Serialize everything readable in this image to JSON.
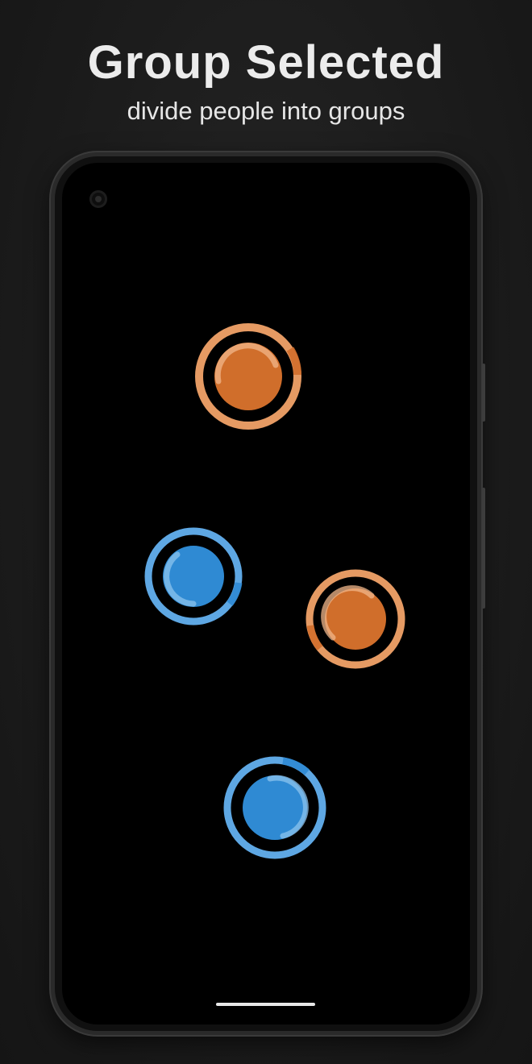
{
  "header": {
    "title": "Group Selected",
    "subtitle": "divide people into groups"
  },
  "colors": {
    "group_orange": "#d06e2b",
    "group_orange_ring": "#e59a63",
    "group_orange_highlight": "#f1b78b",
    "group_blue": "#2f8ad3",
    "group_blue_ring": "#5ea7e3",
    "group_blue_highlight": "#8cc3ee"
  },
  "touch_points": [
    {
      "name": "touch-point-orange-top",
      "group": "orange"
    },
    {
      "name": "touch-point-blue-left",
      "group": "blue"
    },
    {
      "name": "touch-point-orange-right",
      "group": "orange"
    },
    {
      "name": "touch-point-blue-bottom",
      "group": "blue"
    }
  ]
}
